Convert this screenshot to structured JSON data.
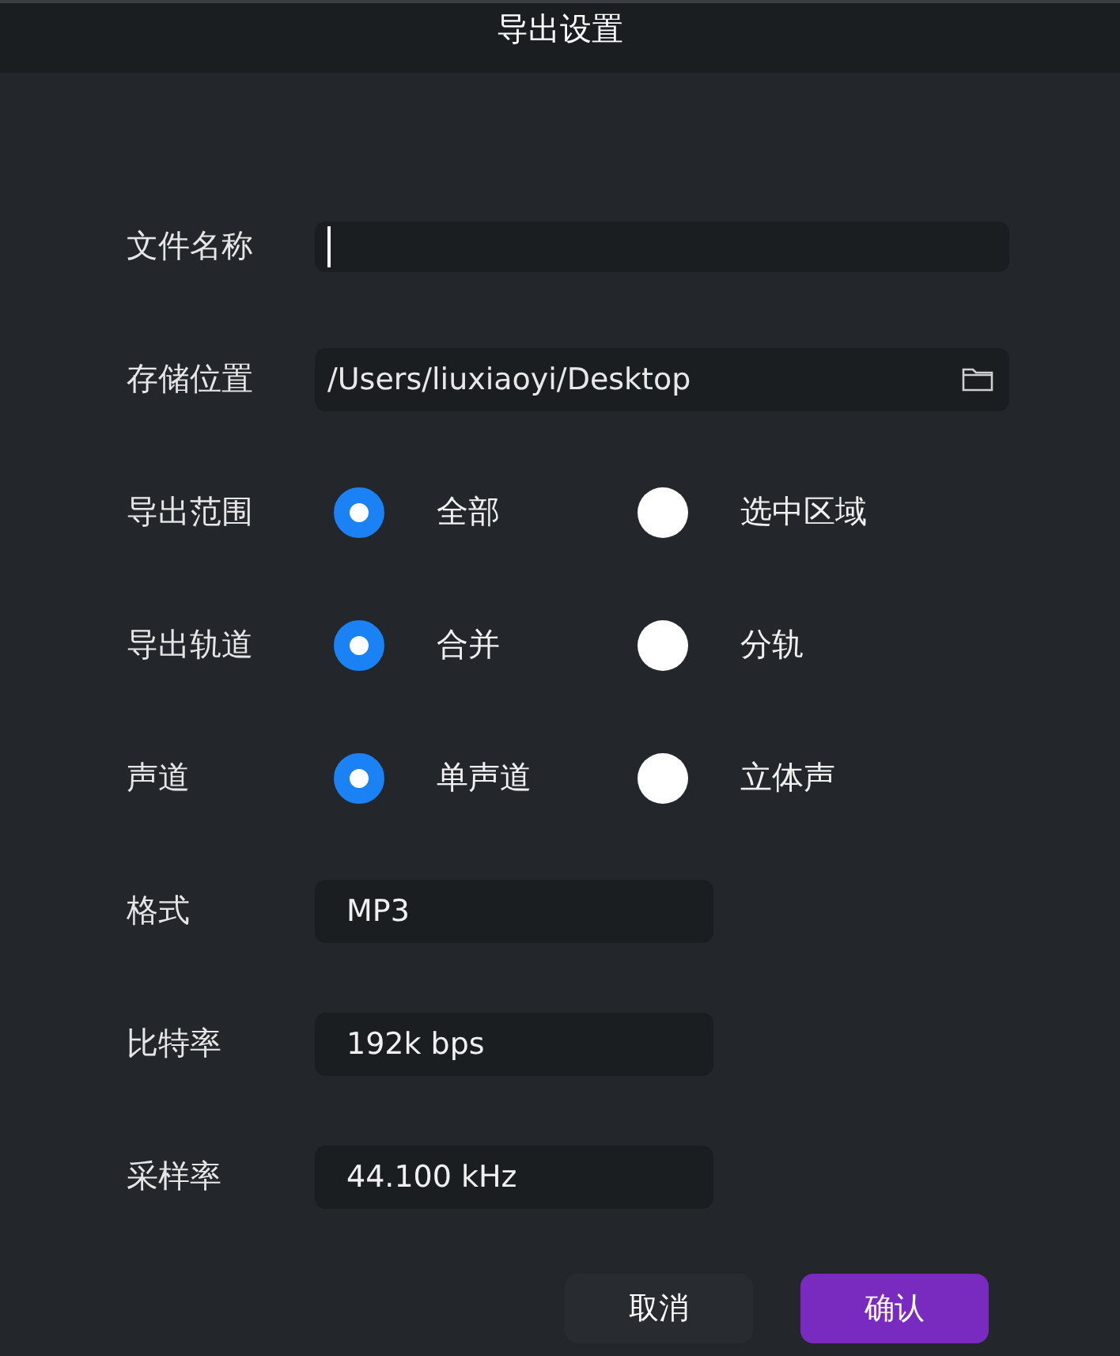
{
  "window": {
    "title": "导出设置"
  },
  "fields": [
    {
      "label": "文件名称",
      "kind": "text",
      "focused": true
    },
    {
      "label": "存储位置",
      "kind": "path",
      "value": "/Users/liuxiaoyi/Desktop"
    }
  ],
  "radio_groups": [
    {
      "label": "导出范围",
      "options": [
        {
          "label": "全部",
          "selected": true
        },
        {
          "label": "选中区域",
          "selected": false
        }
      ]
    },
    {
      "label": "导出轨道",
      "options": [
        {
          "label": "合并",
          "selected": true
        },
        {
          "label": "分轨",
          "selected": false
        }
      ]
    },
    {
      "label": "声道",
      "options": [
        {
          "label": "单声道",
          "selected": true
        },
        {
          "label": "立体声",
          "selected": false
        }
      ]
    }
  ],
  "selects": [
    {
      "label": "格式",
      "value": "MP3"
    },
    {
      "label": "比特率",
      "value": "192k bps"
    },
    {
      "label": "采样率",
      "value": "44.100 kHz"
    }
  ],
  "buttons": [
    {
      "label": "取消",
      "kind": "secondary"
    },
    {
      "label": "确认",
      "kind": "primary"
    }
  ]
}
